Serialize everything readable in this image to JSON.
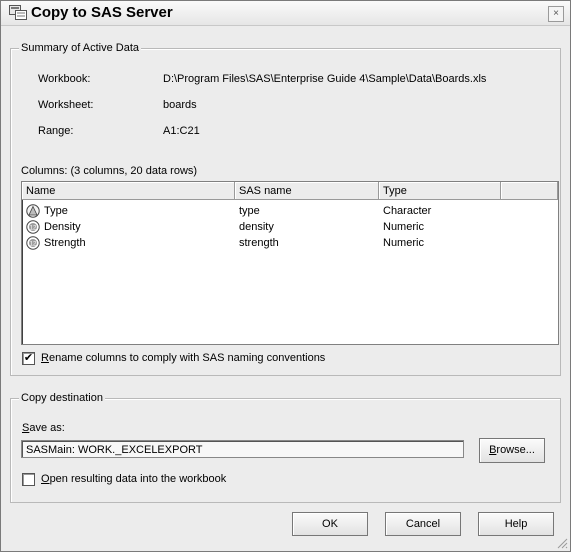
{
  "window": {
    "title": "Copy to SAS Server",
    "close_glyph": "×"
  },
  "summary": {
    "legend": "Summary of Active Data",
    "workbook_label": "Workbook:",
    "workbook_value": "D:\\Program Files\\SAS\\Enterprise Guide 4\\Sample\\Data\\Boards.xls",
    "worksheet_label": "Worksheet:",
    "worksheet_value": "boards",
    "range_label": "Range:",
    "range_value": "A1:C21",
    "columns_caption": "Columns: (3 columns, 20 data rows)",
    "headers": [
      "Name",
      "SAS name",
      "Type"
    ],
    "rows": [
      {
        "name": "Type",
        "sas_name": "type",
        "type": "Character",
        "icon": "character-column-icon"
      },
      {
        "name": "Density",
        "sas_name": "density",
        "type": "Numeric",
        "icon": "numeric-column-icon"
      },
      {
        "name": "Strength",
        "sas_name": "strength",
        "type": "Numeric",
        "icon": "numeric-column-icon"
      }
    ],
    "rename_checked": true,
    "rename_mnemonic": "R",
    "rename_rest": "ename columns to comply with SAS naming conventions"
  },
  "destination": {
    "legend": "Copy destination",
    "saveas_mnemonic": "S",
    "saveas_rest": "ave as:",
    "saveas_value": "SASMain: WORK._EXCELEXPORT",
    "browse_mnemonic": "B",
    "browse_rest": "rowse...",
    "open_checked": false,
    "open_mnemonic": "O",
    "open_rest": "pen resulting data into the workbook"
  },
  "buttons": {
    "ok": "OK",
    "cancel": "Cancel",
    "help": "Help"
  },
  "check_glyph": "✔"
}
